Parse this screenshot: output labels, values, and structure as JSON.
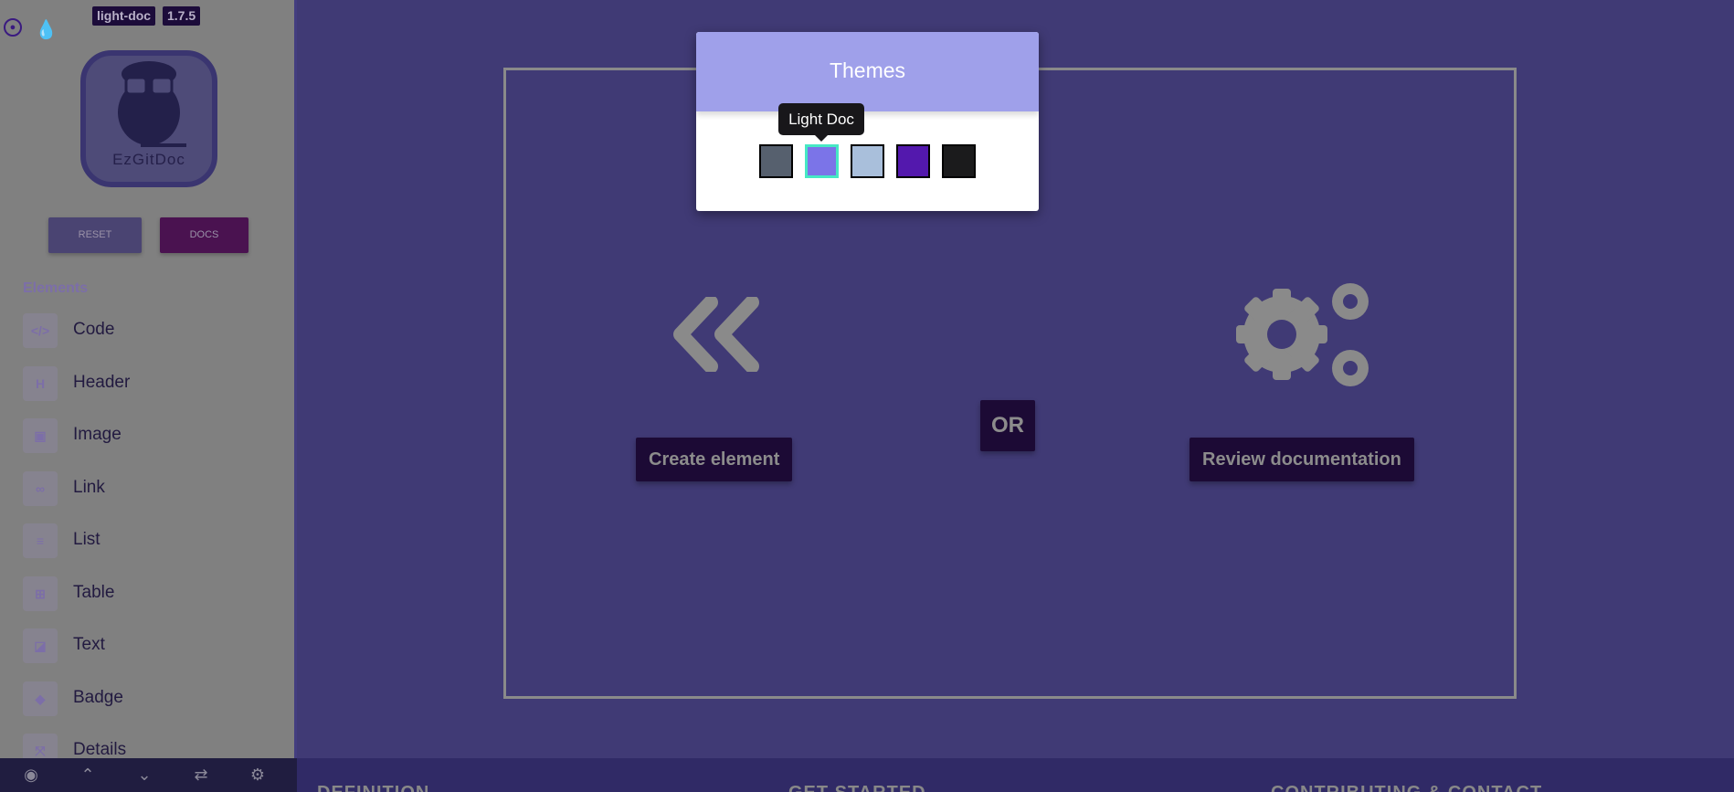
{
  "sidebar": {
    "badges": {
      "name": "light-doc",
      "version": "1.7.5"
    },
    "logo_text": "EzGitDoc",
    "reset_label": "RESET",
    "docs_label": "DOCS",
    "section_title": "Elements",
    "items": [
      {
        "label": "Code",
        "icon": "code-icon",
        "glyph": "</>"
      },
      {
        "label": "Header",
        "icon": "heading-icon",
        "glyph": "H"
      },
      {
        "label": "Image",
        "icon": "image-icon",
        "glyph": "▣"
      },
      {
        "label": "Link",
        "icon": "link-icon",
        "glyph": "∞"
      },
      {
        "label": "List",
        "icon": "list-icon",
        "glyph": "≡"
      },
      {
        "label": "Table",
        "icon": "table-icon",
        "glyph": "⊞"
      },
      {
        "label": "Text",
        "icon": "note-icon",
        "glyph": "◪"
      },
      {
        "label": "Badge",
        "icon": "tag-icon",
        "glyph": "◆"
      },
      {
        "label": "Details",
        "icon": "expand-icon",
        "glyph": "⤧"
      }
    ]
  },
  "toolbar": [
    "eye-icon",
    "chevrons-up-icon",
    "chevrons-down-icon",
    "swap-icon",
    "gear-icon"
  ],
  "main": {
    "create_label": "Create element",
    "or_label": "OR",
    "review_label": "Review documentation"
  },
  "footer": {
    "items": [
      "DEFINITION",
      "GET STARTED",
      "CONTRIBUTING & CONTACT"
    ]
  },
  "themes": {
    "title": "Themes",
    "tooltip": "Light Doc",
    "swatches": [
      "#56606e",
      "#7b74e8",
      "#a9bfdb",
      "#5318ad",
      "#1b1b1c"
    ],
    "selected": 1,
    "selected_border": "#46e8c4"
  }
}
